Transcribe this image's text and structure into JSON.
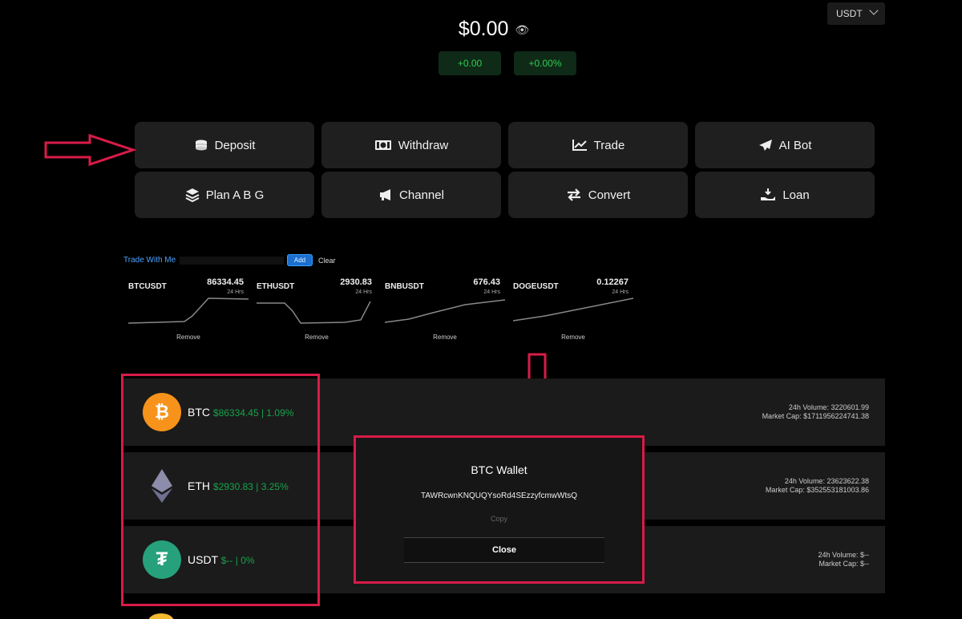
{
  "header": {
    "currency": "USDT",
    "balance": "$0.00",
    "change_amount": "+0.00",
    "change_percent": "+0.00%"
  },
  "actions": [
    {
      "label": "Deposit",
      "icon": "coins-stack-icon"
    },
    {
      "label": "Withdraw",
      "icon": "money-bill-icon"
    },
    {
      "label": "Trade",
      "icon": "chart-line-icon"
    },
    {
      "label": "AI Bot",
      "icon": "paper-plane-icon"
    },
    {
      "label": "Plan A  B  G",
      "icon": "layers-icon"
    },
    {
      "label": "Channel",
      "icon": "megaphone-icon"
    },
    {
      "label": "Convert",
      "icon": "exchange-arrows-icon"
    },
    {
      "label": "Loan",
      "icon": "hand-coin-icon"
    }
  ],
  "trade_strip": {
    "label": "Trade With Me",
    "button": "Add",
    "clear": "Clear"
  },
  "mini_charts": [
    {
      "symbol": "BTCUSDT",
      "price": "86334.45",
      "sub": "24 Hrs",
      "remove": "Remove"
    },
    {
      "symbol": "ETHUSDT",
      "price": "2930.83",
      "sub": "24 Hrs",
      "remove": "Remove"
    },
    {
      "symbol": "BNBUSDT",
      "price": "676.43",
      "sub": "24 Hrs",
      "remove": "Remove"
    },
    {
      "symbol": "DOGEUSDT",
      "price": "0.12267",
      "sub": "24 Hrs",
      "remove": "Remove"
    }
  ],
  "coins": [
    {
      "symbol": "BTC",
      "price_info": "$86334.45 | 1.09%",
      "volume": "24h Volume: 3220601.99",
      "market_cap": "Market Cap: $1711956224741.38"
    },
    {
      "symbol": "ETH",
      "price_info": "$2930.83 | 3.25%",
      "volume": "24h Volume: 23623622.38",
      "market_cap": "Market Cap: $352553181003.86"
    },
    {
      "symbol": "USDT",
      "price_info": "$-- | 0%",
      "volume": "24h Volume: $--",
      "market_cap": "Market Cap: $--"
    }
  ],
  "modal": {
    "title": "BTC Wallet",
    "address": "TAWRcwnKNQUQYsoRd4SEzzyfcmwWtsQ",
    "copy": "Copy",
    "close": "Close"
  },
  "colors": {
    "accent_green": "#16a34a",
    "highlight_red": "#d81b48",
    "link_blue": "#4aa3ff"
  }
}
